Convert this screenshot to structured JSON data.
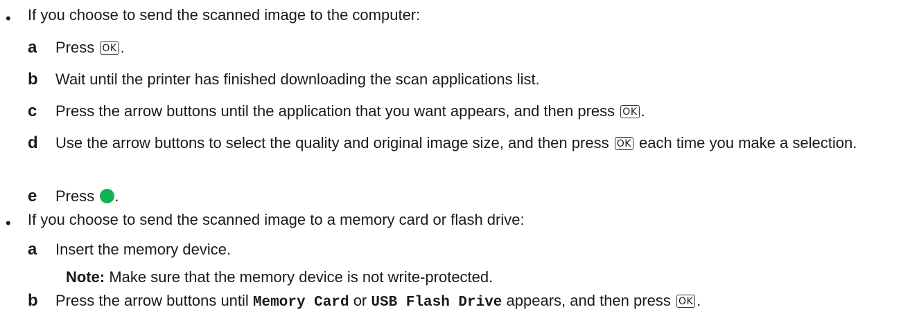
{
  "computer_section": {
    "bullet": "•",
    "intro": "If you choose to send the scanned image to the computer:",
    "steps": [
      {
        "letter": "a",
        "pre": "Press",
        "post": "."
      },
      {
        "letter": "b",
        "text": "Wait until the printer has finished downloading the scan applications list."
      },
      {
        "letter": "c",
        "pre": "Press the arrow buttons until the application that you want appears, and then press",
        "post": "."
      },
      {
        "letter": "d",
        "pre": "Use the arrow buttons to select the quality and original image size, and then press",
        "post": "each time you make a selection."
      },
      {
        "letter": "e",
        "pre": "Press",
        "post": "."
      }
    ]
  },
  "memory_section": {
    "bullet": "•",
    "intro": "If you choose to send the scanned image to a memory card or flash drive:",
    "steps": [
      {
        "letter": "a",
        "text": "Insert the memory device."
      },
      {
        "letter": "b",
        "pre": "Press the arrow buttons until",
        "option1": "Memory Card",
        "mid": "or",
        "option2": "USB Flash Drive",
        "post_pre": "appears, and then press",
        "post": "."
      }
    ],
    "note_label": "Note:",
    "note_text": "Make sure that the memory device is not write-protected."
  },
  "ok_key_label": "OK",
  "icons": {
    "ok_key": "ok-button-icon",
    "start": "start-button-icon",
    "start_color": "#10b055"
  }
}
